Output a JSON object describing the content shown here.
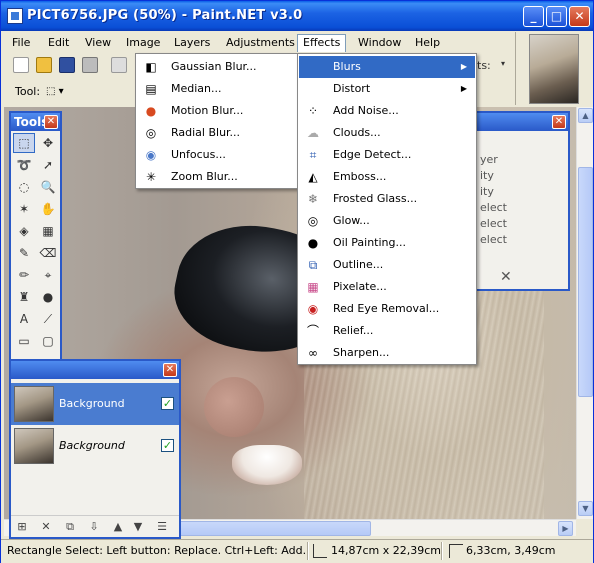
{
  "window": {
    "title": "PICT6756.JPG (50%) - Paint.NET v3.0",
    "buttons": {
      "minimize": "_",
      "maximize": "□",
      "close": "✕"
    }
  },
  "menubar": [
    "File",
    "Edit",
    "View",
    "Image",
    "Layers",
    "Adjustments",
    "Effects",
    "Window",
    "Help"
  ],
  "toolbar": {
    "tool_label": "Tool:",
    "tool_value": "⬚ ▾",
    "partial_label": "ts:"
  },
  "effects_menu": [
    {
      "label": "Blurs",
      "icon": "blurs-icon",
      "submenu": true,
      "highlighted": true
    },
    {
      "label": "Distort",
      "icon": "distort-icon",
      "submenu": true
    },
    {
      "label": "Add Noise...",
      "icon": "noise-icon"
    },
    {
      "label": "Clouds...",
      "icon": "clouds-icon"
    },
    {
      "label": "Edge Detect...",
      "icon": "edge-detect-icon"
    },
    {
      "label": "Emboss...",
      "icon": "emboss-icon"
    },
    {
      "label": "Frosted Glass...",
      "icon": "frosted-glass-icon"
    },
    {
      "label": "Glow...",
      "icon": "glow-icon"
    },
    {
      "label": "Oil Painting...",
      "icon": "oil-painting-icon"
    },
    {
      "label": "Outline...",
      "icon": "outline-icon"
    },
    {
      "label": "Pixelate...",
      "icon": "pixelate-icon"
    },
    {
      "label": "Red Eye Removal...",
      "icon": "red-eye-icon"
    },
    {
      "label": "Relief...",
      "icon": "relief-icon"
    },
    {
      "label": "Sharpen...",
      "icon": "sharpen-icon"
    }
  ],
  "blurs_menu": [
    {
      "label": "Gaussian Blur...",
      "icon": "gaussian-blur-icon"
    },
    {
      "label": "Median...",
      "icon": "median-icon"
    },
    {
      "label": "Motion Blur...",
      "icon": "motion-blur-icon"
    },
    {
      "label": "Radial Blur...",
      "icon": "radial-blur-icon"
    },
    {
      "label": "Unfocus...",
      "icon": "unfocus-icon"
    },
    {
      "label": "Zoom Blur...",
      "icon": "zoom-blur-icon"
    }
  ],
  "tools_palette": {
    "title": "Tools",
    "close": "✕"
  },
  "layers_palette": {
    "close": "✕",
    "layers": [
      {
        "name": "Background",
        "selected": true,
        "visible": true
      },
      {
        "name": "Background",
        "selected": false,
        "visible": true
      }
    ]
  },
  "history_palette": {
    "close": "✕",
    "items": [
      "yer",
      "ity",
      "ity",
      "elect",
      "elect",
      "elect"
    ]
  },
  "statusbar": {
    "message": "Rectangle Select: Left button: Replace. Ctrl+Left: Add. Right",
    "size": "14,87cm x 22,39cm",
    "position": "6,33cm, 3,49cm"
  },
  "colors": {
    "titlebar": "#0a4fd6",
    "menu_highlight": "#316ac5",
    "palette_border": "#2a59c8",
    "chrome": "#ece9d8"
  }
}
